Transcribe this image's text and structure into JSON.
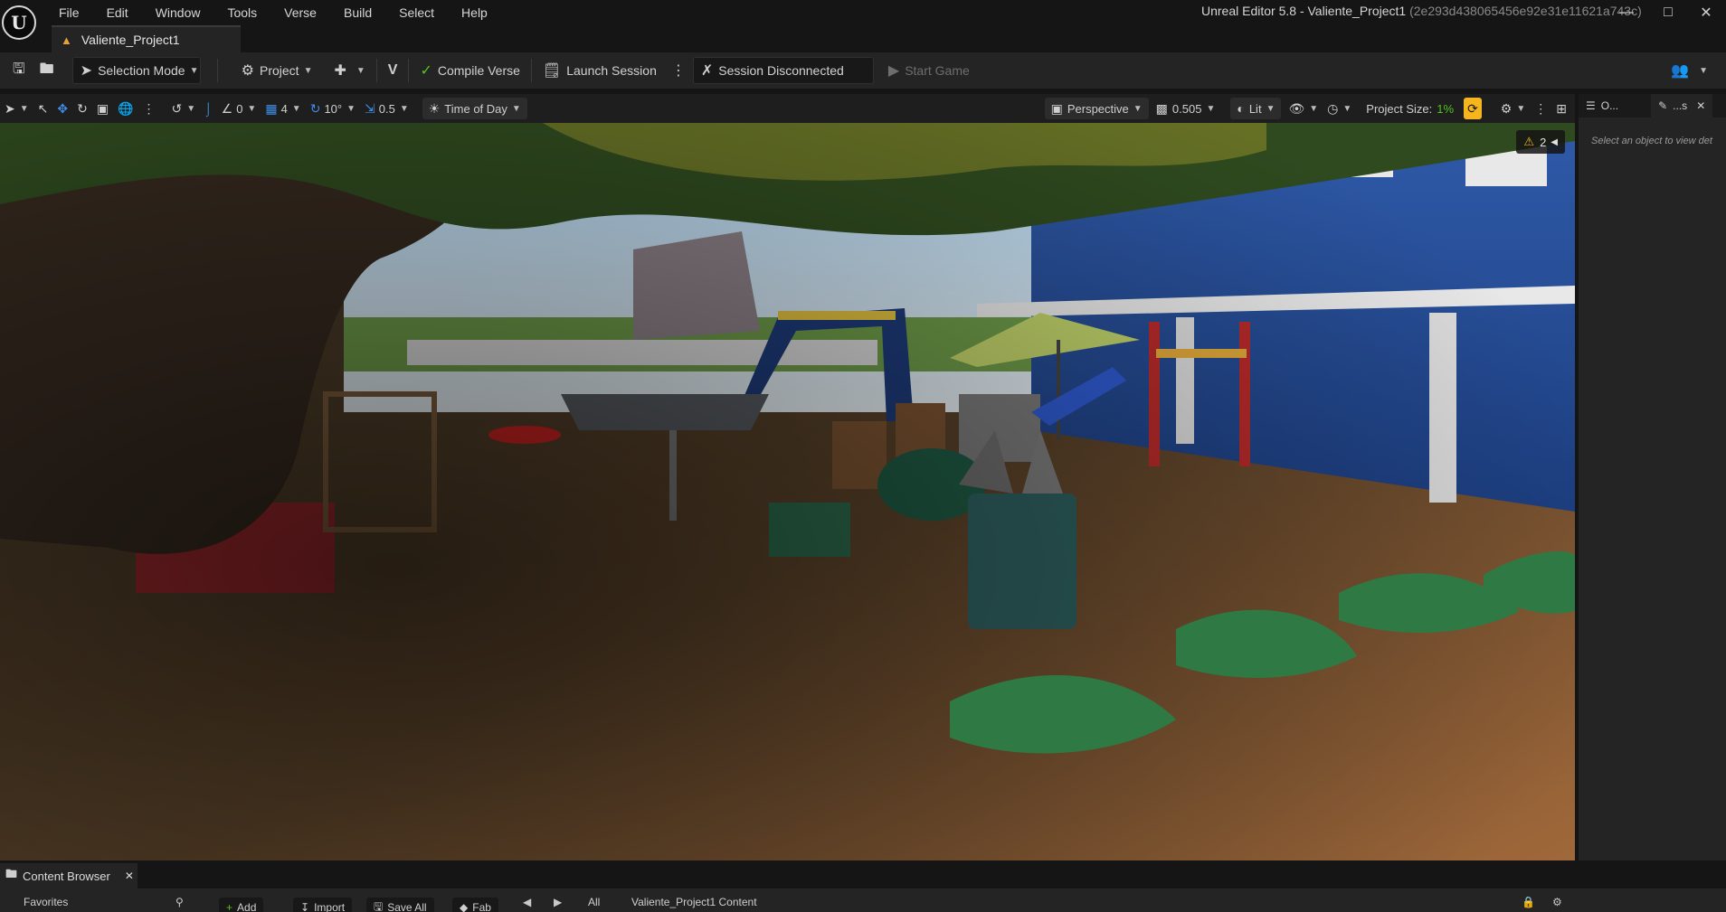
{
  "window": {
    "title": "Unreal Editor 5.8 - Valiente_Project1",
    "hash": "(2e293d438065456e92e31e11621a743c)"
  },
  "menu": [
    "File",
    "Edit",
    "Window",
    "Tools",
    "Verse",
    "Build",
    "Select",
    "Help"
  ],
  "document_tab": {
    "label": "Valiente_Project1"
  },
  "toolbar": {
    "selection_mode": "Selection Mode",
    "project": "Project",
    "compile_verse": "Compile Verse",
    "launch_session": "Launch Session",
    "session_status": "Session Disconnected",
    "start_game": "Start Game"
  },
  "viewport_toolbar": {
    "snap_rotate_value": "0",
    "grid_value": "4",
    "rotate_snap": "10°",
    "scale_snap": "0.5",
    "time_of_day": "Time of Day",
    "view_mode": "Perspective",
    "camera_speed": "0.505",
    "lighting": "Lit",
    "project_size_label": "Project Size:",
    "project_size_value": "1%"
  },
  "viewport": {
    "warning_count": "2"
  },
  "details_panel": {
    "tab_outliner": "O...",
    "tab_details": "...s",
    "empty_message": "Select an object to view det"
  },
  "content_browser": {
    "tab": "Content Browser",
    "favorites": "Favorites",
    "add": "Add",
    "import": "Import",
    "save_all": "Save All",
    "fab": "Fab",
    "path_all": "All",
    "path_content": "Valiente_Project1 Content"
  },
  "colors": {
    "accent_orange": "#f5b51c",
    "blue_ui": "#3d8fe8",
    "green_pct": "#52c41a"
  }
}
